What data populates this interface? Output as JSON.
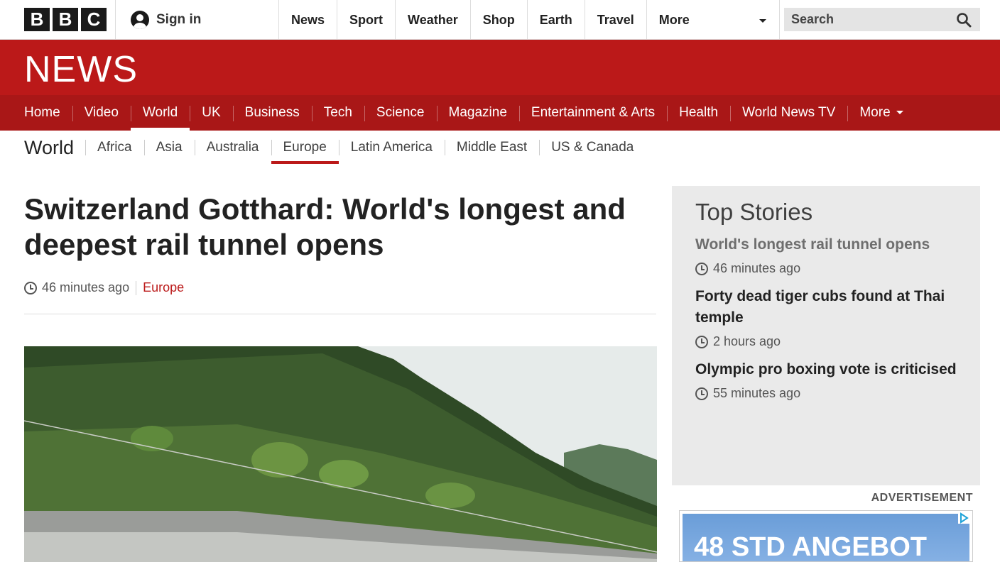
{
  "global": {
    "logo_letters": [
      "B",
      "B",
      "C"
    ],
    "signin_label": "Sign in",
    "nav": [
      "News",
      "Sport",
      "Weather",
      "Shop",
      "Earth",
      "Travel",
      "More"
    ],
    "search_placeholder": "Search"
  },
  "news_header": {
    "wordmark": "NEWS",
    "nav": [
      "Home",
      "Video",
      "World",
      "UK",
      "Business",
      "Tech",
      "Science",
      "Magazine",
      "Entertainment & Arts",
      "Health",
      "World News TV",
      "More"
    ],
    "active": "World"
  },
  "subnav": {
    "section_title": "World",
    "items": [
      "Africa",
      "Asia",
      "Australia",
      "Europe",
      "Latin America",
      "Middle East",
      "US & Canada"
    ],
    "active": "Europe"
  },
  "article": {
    "headline": "Switzerland Gotthard: World's longest and deepest rail tunnel opens",
    "timestamp": "46 minutes ago",
    "section": "Europe"
  },
  "top_stories": {
    "title": "Top Stories",
    "stories": [
      {
        "title": "World's longest rail tunnel opens",
        "time": "46 minutes ago"
      },
      {
        "title": "Forty dead tiger cubs found at Thai temple",
        "time": "2 hours ago"
      },
      {
        "title": "Olympic pro boxing vote is criticised",
        "time": "55 minutes ago"
      }
    ]
  },
  "ad": {
    "label": "ADVERTISEMENT",
    "text": "48 STD ANGEBOT"
  },
  "colors": {
    "brand_red": "#bb1919",
    "nav_red": "#a91717",
    "panel_grey": "#eaeaea"
  }
}
